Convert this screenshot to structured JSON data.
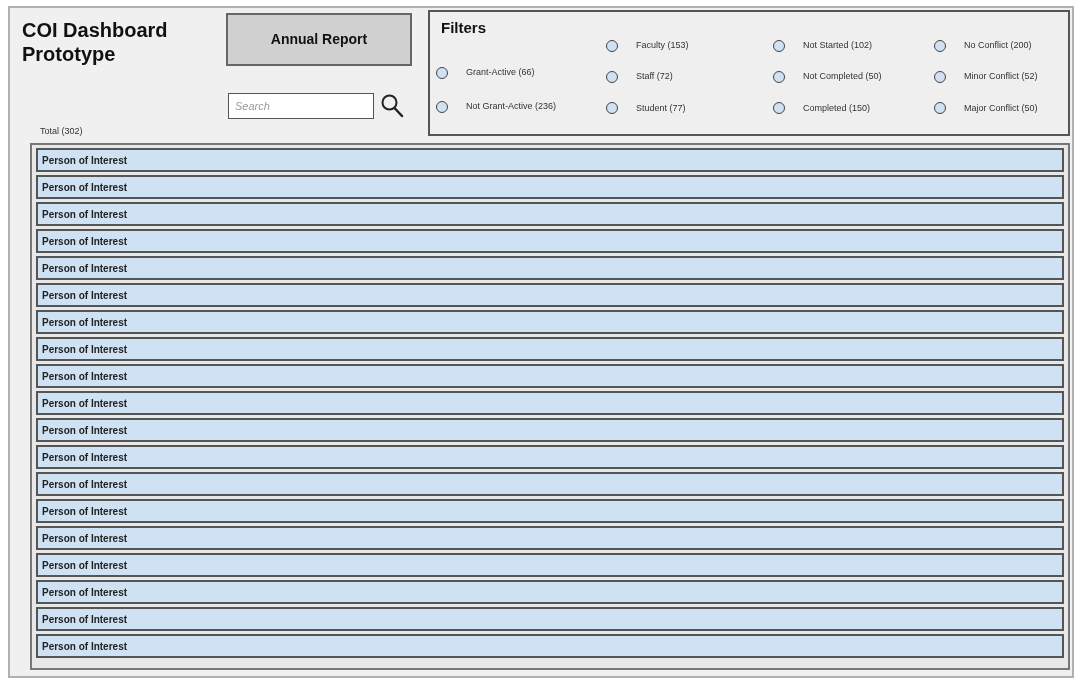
{
  "title": "COI Dashboard Prototype",
  "annual_report_button": "Annual Report",
  "search": {
    "placeholder": "Search"
  },
  "total": "Total (302)",
  "filters": {
    "title": "Filters",
    "columns": [
      [
        {
          "label": "Grant-Active (66)",
          "selected": false
        },
        {
          "label": "Not Grant-Active (236)",
          "selected": false
        }
      ],
      [
        {
          "label": "Faculty (153)",
          "selected": false
        },
        {
          "label": "Staff (72)",
          "selected": false
        },
        {
          "label": "Student (77)",
          "selected": false
        }
      ],
      [
        {
          "label": "Not Started (102)",
          "selected": false
        },
        {
          "label": "Not Completed (50)",
          "selected": false
        },
        {
          "label": "Completed (150)",
          "selected": false
        }
      ],
      [
        {
          "label": "No Conflict (200)",
          "selected": false
        },
        {
          "label": "Minor Conflict (52)",
          "selected": false
        },
        {
          "label": "Major Conflict (50)",
          "selected": false
        }
      ]
    ]
  },
  "rows": [
    {
      "label": "Person of Interest"
    },
    {
      "label": "Person of Interest"
    },
    {
      "label": "Person of Interest"
    },
    {
      "label": "Person of Interest"
    },
    {
      "label": "Person of Interest"
    },
    {
      "label": "Person of Interest"
    },
    {
      "label": "Person of Interest"
    },
    {
      "label": "Person of Interest"
    },
    {
      "label": "Person of Interest"
    },
    {
      "label": "Person of Interest"
    },
    {
      "label": "Person of Interest"
    },
    {
      "label": "Person of Interest"
    },
    {
      "label": "Person of Interest"
    },
    {
      "label": "Person of Interest"
    },
    {
      "label": "Person of Interest"
    },
    {
      "label": "Person of Interest"
    },
    {
      "label": "Person of Interest"
    },
    {
      "label": "Person of Interest"
    },
    {
      "label": "Person of Interest"
    }
  ]
}
